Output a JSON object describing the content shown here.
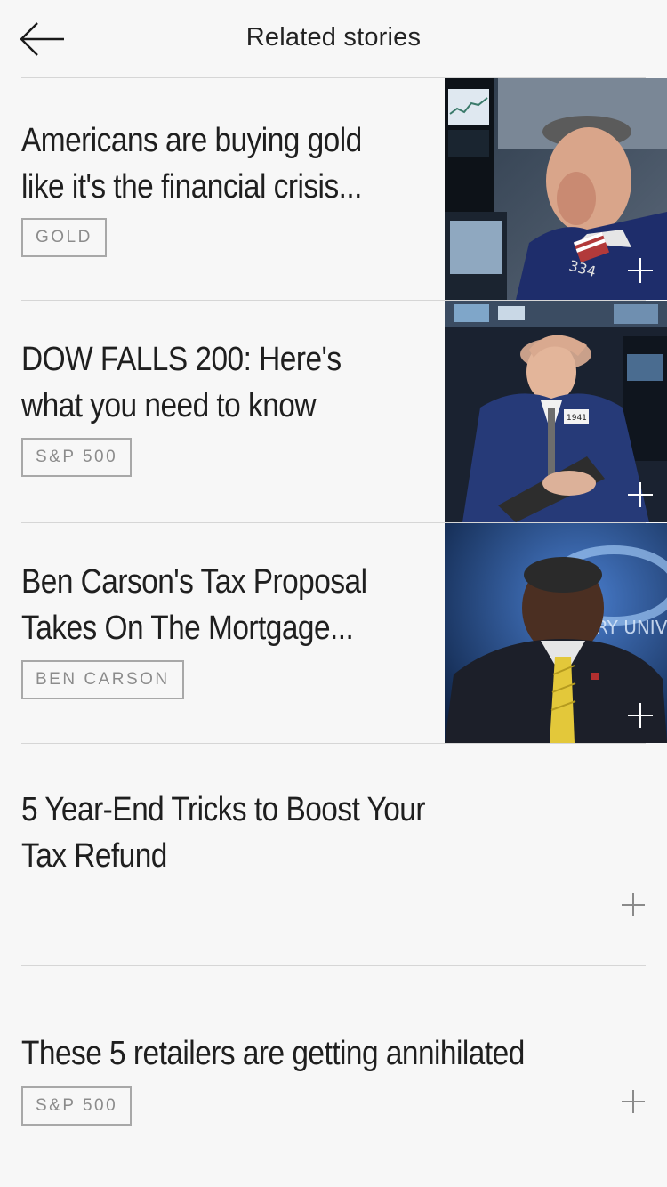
{
  "header": {
    "title": "Related stories",
    "back_icon": "arrow-left-icon"
  },
  "stories": [
    {
      "title_line1": "Americans are buying gold",
      "title_line2": "like it's the financial crisis...",
      "tag": "GOLD",
      "has_image": true,
      "image_subject": "trader with hand over mouth at stock exchange",
      "action_icon": "plus-icon"
    },
    {
      "title_line1": "DOW FALLS 200: Here's",
      "title_line2": "what you need to know",
      "tag": "S&P 500",
      "has_image": true,
      "image_subject": "trader with hand on head at stock exchange",
      "action_icon": "plus-icon"
    },
    {
      "title_line1": "Ben Carson's Tax Proposal",
      "title_line2": "Takes On The Mortgage...",
      "tag": "BEN CARSON",
      "has_image": true,
      "image_subject": "man in suit and yellow tie looking down",
      "action_icon": "plus-icon"
    },
    {
      "title_line1": "5 Year-End Tricks to Boost Your",
      "title_line2": "Tax Refund",
      "tag": "",
      "has_image": false,
      "action_icon": "plus-icon"
    },
    {
      "title_line1": "These 5 retailers are getting annihilated",
      "title_line2": "",
      "tag": "S&P 500",
      "has_image": false,
      "action_icon": "plus-icon"
    }
  ],
  "colors": {
    "background": "#f7f7f7",
    "text": "#1f1f1f",
    "divider": "#d6d6d6",
    "tag_border": "#a8a8a8",
    "tag_text": "#8c8c8c"
  }
}
